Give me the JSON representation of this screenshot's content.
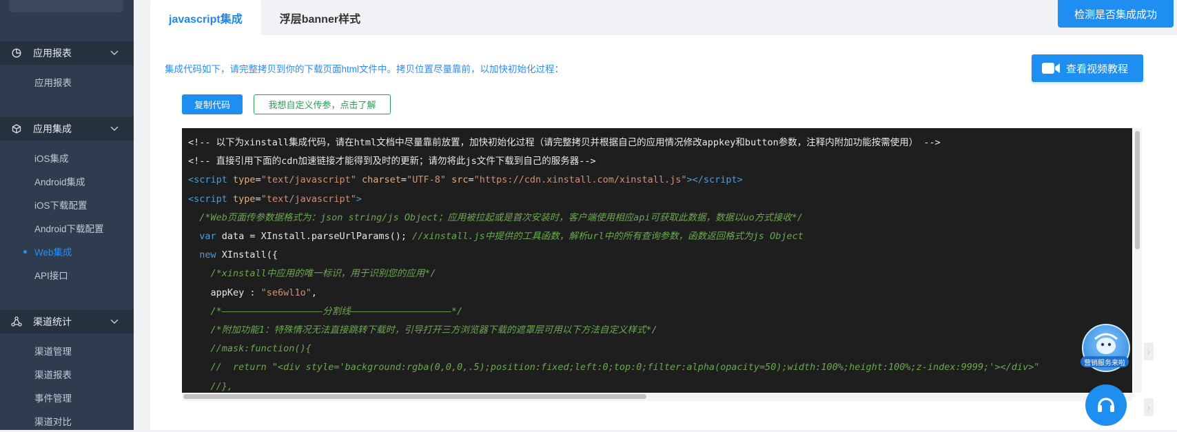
{
  "sidebar": {
    "sections": [
      {
        "label": "应用报表",
        "icon": "pie-chart-icon",
        "items": [
          {
            "label": "应用报表"
          }
        ]
      },
      {
        "label": "应用集成",
        "icon": "cube-icon",
        "items": [
          {
            "label": "iOS集成"
          },
          {
            "label": "Android集成"
          },
          {
            "label": "iOS下载配置"
          },
          {
            "label": "Android下载配置"
          },
          {
            "label": "Web集成",
            "active": true
          },
          {
            "label": "API接口"
          }
        ]
      },
      {
        "label": "渠道统计",
        "icon": "share-nodes-icon",
        "items": [
          {
            "label": "渠道管理"
          },
          {
            "label": "渠道报表"
          },
          {
            "label": "事件管理"
          },
          {
            "label": "渠道对比"
          }
        ]
      }
    ]
  },
  "tabs": [
    {
      "label": "javascript集成",
      "active": true
    },
    {
      "label": "浮层banner样式",
      "active": false
    }
  ],
  "header": {
    "check_button": "检测是否集成成功"
  },
  "content": {
    "hint": "集成代码如下，请完整拷贝到你的下载页面html文件中。拷贝位置尽量靠前，以加快初始化过程：",
    "video_button": "查看视频教程",
    "copy_button": "复制代码",
    "custom_button": "我想自定义传参，点击了解"
  },
  "code": {
    "line1": "<!-- 以下为xinstall集成代码，请在html文档中尽量靠前放置，加快初始化过程（请完整拷贝并根据自己的应用情况修改appkey和button参数，注释内附加功能按需使用） -->",
    "line2": "<!-- 直接引用下面的cdn加速链接才能得到及时的更新；请勿将此js文件下载到自己的服务器-->",
    "script_open": "<script",
    "attr_type": "type",
    "attr_type_val": "\"text/javascript\"",
    "attr_charset": "charset",
    "attr_charset_val": "\"UTF-8\"",
    "attr_src": "src",
    "attr_src_val": "\"https://cdn.xinstall.com/xinstall.js\"",
    "tag_close_open": "></",
    "tag_script": "script",
    "tag_gt": ">",
    "line5": "/*Web页面传参数据格式为：json string/js Object；应用被拉起或是首次安装时，客户端使用相应api可获取此数据，数据以uo方式接收*/",
    "kw_var": "var",
    "line6_code": " data = XInstall.parseUrlParams(); ",
    "line6_cmt": "//xinstall.js中提供的工具函数，解析url中的所有查询参数，函数返回格式为js Object",
    "kw_new": "new",
    "line7_code": " XInstall({",
    "line8": "/*xinstall中应用的唯一标识，用于识别您的应用*/",
    "line9_key": "appKey : ",
    "line9_val": "\"se6wl1o\"",
    "line9_end": ",",
    "line10": "/*——————————————————分割线——————————————————*/",
    "line11": "/*附加功能1：特殊情况无法直接跳转下载时，引导打开三方浏览器下载的遮罩层可用以下方法自定义样式*/",
    "line12": "//mask:function(){",
    "line13": "//  return \"<div style='background:rgba(0,0,0,.5);position:fixed;left:0;top:0;filter:alpha(opacity=50);width:100%;height:100%;z-index:9999;'></div>\"",
    "line14": "//},"
  },
  "widgets": {
    "service_badge": "营销服务来啦"
  }
}
